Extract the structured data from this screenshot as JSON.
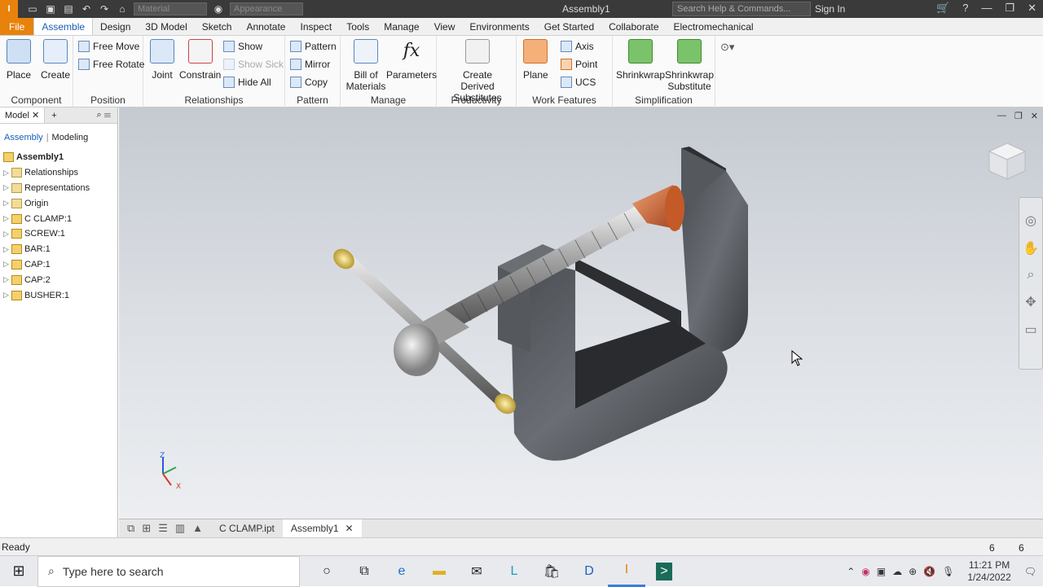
{
  "app": {
    "logo_text": "I",
    "window_title": "Assembly1",
    "material_placeholder": "Material",
    "appearance_placeholder": "Appearance",
    "search_placeholder": "Search Help & Commands...",
    "sign_in": "Sign In"
  },
  "ribbon_tabs": [
    "File",
    "Assemble",
    "Design",
    "3D Model",
    "Sketch",
    "Annotate",
    "Inspect",
    "Tools",
    "Manage",
    "View",
    "Environments",
    "Get Started",
    "Collaborate",
    "Electromechanical"
  ],
  "ribbon": {
    "component": {
      "title": "Component",
      "place": "Place",
      "create": "Create"
    },
    "position": {
      "title": "Position",
      "free_move": "Free Move",
      "free_rotate": "Free Rotate"
    },
    "relationships": {
      "title": "Relationships",
      "joint": "Joint",
      "constrain": "Constrain",
      "show": "Show",
      "show_sick": "Show Sick",
      "hide_all": "Hide All"
    },
    "pattern": {
      "title": "Pattern",
      "pattern": "Pattern",
      "mirror": "Mirror",
      "copy": "Copy"
    },
    "manage": {
      "title": "Manage",
      "bom": "Bill of Materials",
      "parameters": "Parameters"
    },
    "productivity": {
      "title": "Productivity",
      "derived": "Create Derived Substitutes"
    },
    "work_features": {
      "title": "Work Features",
      "plane": "Plane",
      "axis": "Axis",
      "point": "Point",
      "ucs": "UCS"
    },
    "simplification": {
      "title": "Simplification",
      "shrinkwrap": "Shrinkwrap",
      "shrinkwrap_sub": "Shrinkwrap Substitute"
    }
  },
  "browser": {
    "tab": "Model",
    "modes": [
      "Assembly",
      "Modeling"
    ],
    "root": "Assembly1",
    "items": [
      "Relationships",
      "Representations",
      "Origin",
      "C CLAMP:1",
      "SCREW:1",
      "BAR:1",
      "CAP:1",
      "CAP:2",
      "BUSHER:1"
    ]
  },
  "doc_tabs": [
    "C CLAMP.ipt",
    "Assembly1"
  ],
  "status": {
    "text": "Ready",
    "num1": "6",
    "num2": "6"
  },
  "taskbar": {
    "search_placeholder": "Type here to search",
    "time": "11:21 PM",
    "date": "1/24/2022"
  },
  "colors": {
    "accent": "#e8820c",
    "ribbon_active": "#1a5fb4"
  }
}
